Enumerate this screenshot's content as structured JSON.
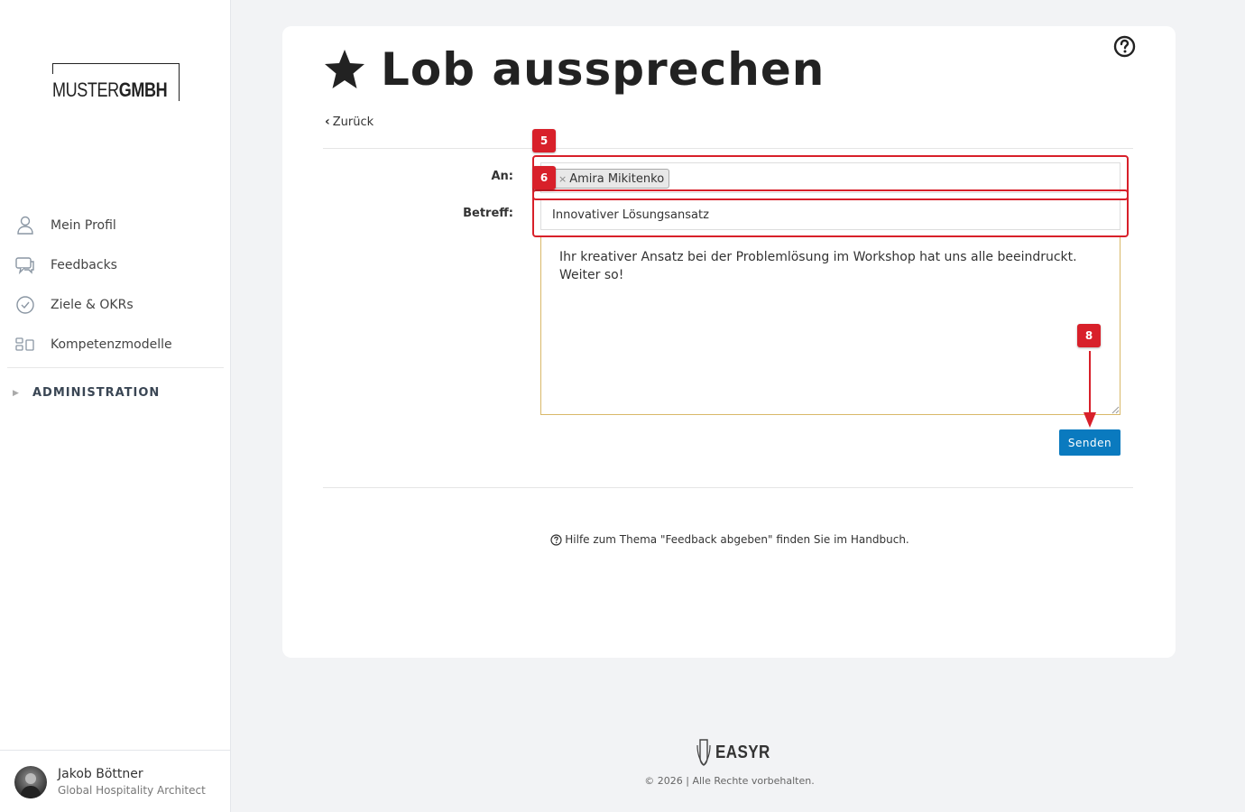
{
  "sidebar": {
    "logo": {
      "part1": "MUSTER",
      "part2": "GMBH"
    },
    "nav": [
      {
        "label": "Mein Profil",
        "icon": "person-icon"
      },
      {
        "label": "Feedbacks",
        "icon": "chat-bubbles-icon"
      },
      {
        "label": "Ziele & OKRs",
        "icon": "check-circle-icon"
      },
      {
        "label": "Kompetenzmodelle",
        "icon": "competence-grid-icon"
      }
    ],
    "admin": {
      "label": "ADMINISTRATION",
      "icon": "triangle-right-icon"
    },
    "user": {
      "name": "Jakob Böttner",
      "role": "Global Hospitality Architect"
    }
  },
  "main": {
    "title": "Lob aussprechen",
    "title_icon": "star-icon",
    "help_icon": "question-circle-icon",
    "back_label": "Zurück",
    "form": {
      "to_label": "An:",
      "recipient": "Amira Mikitenko",
      "subject_label": "Betreff:",
      "subject_value": "Innovativer Lösungsansatz",
      "message": "Ihr kreativer Ansatz bei der Problemlösung im Workshop hat uns alle beeindruckt. Weiter so!",
      "send_label": "Senden"
    },
    "handbook_text": "Hilfe zum Thema \"Feedback abgeben\" finden Sie im Handbuch."
  },
  "annotations": [
    {
      "number": "5"
    },
    {
      "number": "6"
    },
    {
      "number": "8"
    }
  ],
  "footer": {
    "brand": "EASYR",
    "copyright": "© 2026 | Alle Rechte vorbehalten."
  },
  "colors": {
    "accent": "#0a7abf",
    "annotation": "#d8202a",
    "textarea_border": "#d9b969"
  }
}
